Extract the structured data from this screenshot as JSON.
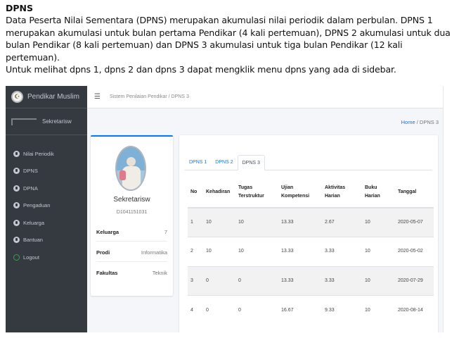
{
  "doc": {
    "title": "DPNS",
    "paragraphs": [
      "Data Peserta Nilai Sementara (DPNS) merupakan akumulasi nilai periodik dalam perbulan. DPNS 1 merupakan akumulasi untuk bulan pertama Pendikar (4 kali pertemuan), DPNS 2 akumulasi untuk dua bulan Pendikar (8 kali pertemuan) dan DPNS 3 akumulasi untuk tiga bulan Pendikar (12 kali pertemuan).",
      "Untuk melihat dpns 1, dpns 2 dan dpns 3 dapat mengklik menu dpns yang ada di sidebar."
    ]
  },
  "app": {
    "brand": "Pendikar Muslim",
    "user": "Sekretarisw",
    "topbar_crumb": "Sistem Penilaian Pendikar / DPNS 3",
    "breadcrumb": {
      "home": "Home",
      "sep": "/",
      "current": "DPNS 3"
    },
    "menu": [
      {
        "label": "Nilai Periodik",
        "icon": "circle-icon"
      },
      {
        "label": "DPNS",
        "icon": "circle-icon"
      },
      {
        "label": "DPNA",
        "icon": "circle-icon"
      },
      {
        "label": "Pengaduan",
        "icon": "circle-icon"
      },
      {
        "label": "Keluarga",
        "icon": "circle-icon"
      },
      {
        "label": "Bantuan",
        "icon": "circle-icon"
      },
      {
        "label": "Logout",
        "icon": "ring-icon"
      }
    ]
  },
  "profile": {
    "name": "Sekretarisw",
    "id": "D1041151031",
    "rows": [
      {
        "key": "Keluarga",
        "value": "7"
      },
      {
        "key": "Prodi",
        "value": "Informatika"
      },
      {
        "key": "Fakultas",
        "value": "Teknik"
      }
    ]
  },
  "tabs": [
    "DPNS 1",
    "DPNS 2",
    "DPNS 3"
  ],
  "active_tab": "DPNS 3",
  "table": {
    "headers": [
      "No",
      "Kehadiran",
      "Tugas Terstruktur",
      "Ujian Kompetensi",
      "Aktivitas Harian",
      "Buku Harian",
      "Tanggal"
    ],
    "rows": [
      [
        "1",
        "10",
        "10",
        "13.33",
        "2.67",
        "10",
        "2020-05-07"
      ],
      [
        "2",
        "10",
        "10",
        "13.33",
        "3.33",
        "10",
        "2020-05-02"
      ],
      [
        "3",
        "0",
        "0",
        "13.33",
        "3.33",
        "10",
        "2020-07-29"
      ],
      [
        "4",
        "0",
        "0",
        "16.67",
        "9.33",
        "10",
        "2020-08-14"
      ]
    ]
  },
  "colors": {
    "sidebar": "#343a40",
    "accent": "#007bff",
    "logout_ring": "#28a745"
  }
}
